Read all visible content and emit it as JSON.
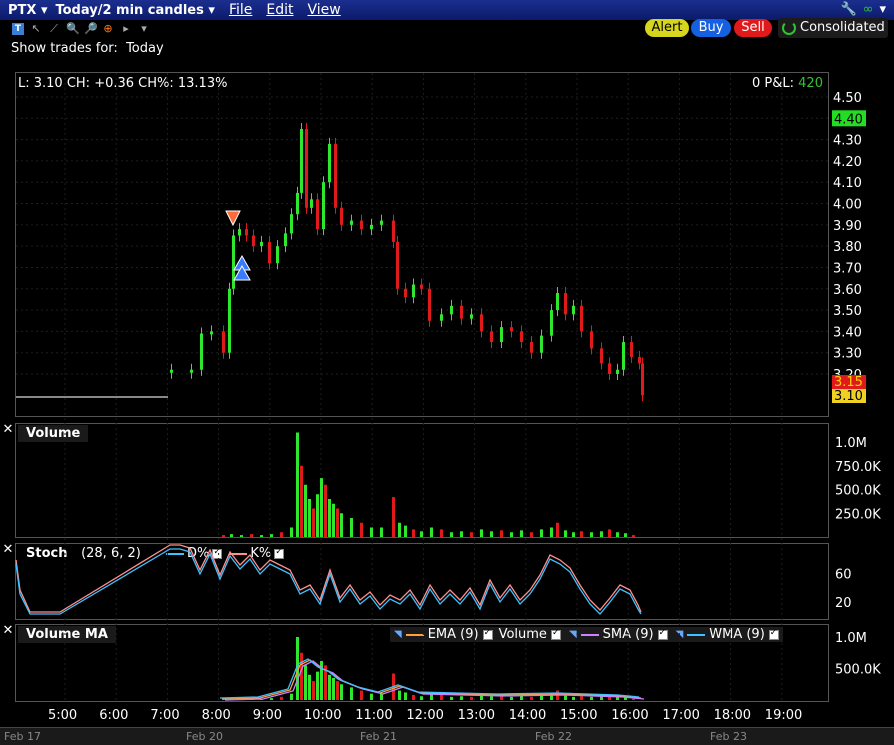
{
  "window": {
    "symbol": "PTX",
    "timeframe": "Today/2 min candles",
    "menus": [
      "File",
      "Edit",
      "View"
    ]
  },
  "toolbar": {
    "alert": "Alert",
    "buy": "Buy",
    "sell": "Sell",
    "consolidated": "Consolidated",
    "show_trades": "Show trades for:",
    "show_trades_value": "Today"
  },
  "price_panel": {
    "info": "L: 3.10 CH: +0.36 CH%: 13.13%",
    "pnl_label": "0 P&L:",
    "pnl_value": "420",
    "y_ticks": [
      "4.50",
      "4.40",
      "4.30",
      "4.20",
      "4.10",
      "4.00",
      "3.90",
      "3.80",
      "3.70",
      "3.60",
      "3.50",
      "3.40",
      "3.30",
      "3.20",
      "3.15",
      "3.10"
    ],
    "last_price": "4.40",
    "tag_red": "3.15",
    "tag_yellow": "3.10",
    "colors": {
      "up": "#2ee82e",
      "down": "#e01a1a",
      "last": "#22dd22"
    }
  },
  "volume_panel": {
    "label": "Volume",
    "y_ticks": [
      "1.0M",
      "750.0K",
      "500.0K",
      "250.0K"
    ]
  },
  "stoch_panel": {
    "label": "Stoch",
    "params": "(28, 6, 2)",
    "d_label": "D%",
    "k_label": "K%",
    "y_ticks": [
      "60",
      "20"
    ]
  },
  "volma_panel": {
    "label": "Volume MA",
    "legend": [
      {
        "name": "EMA (9)",
        "color": "#ffa040"
      },
      {
        "name": "Volume",
        "color": ""
      },
      {
        "name": "SMA (9)",
        "color": "#d080ff"
      },
      {
        "name": "WMA (9)",
        "color": "#40c0ff"
      }
    ],
    "y_ticks": [
      "1.0M",
      "500.0K"
    ]
  },
  "x_axis": {
    "times": [
      "5:00",
      "6:00",
      "7:00",
      "8:00",
      "9:00",
      "10:00",
      "11:00",
      "12:00",
      "13:00",
      "14:00",
      "15:00",
      "16:00",
      "17:00",
      "18:00",
      "19:00"
    ],
    "dates": [
      "Feb 17",
      "Feb 20",
      "Feb 21",
      "Feb 22",
      "Feb 23"
    ]
  }
}
